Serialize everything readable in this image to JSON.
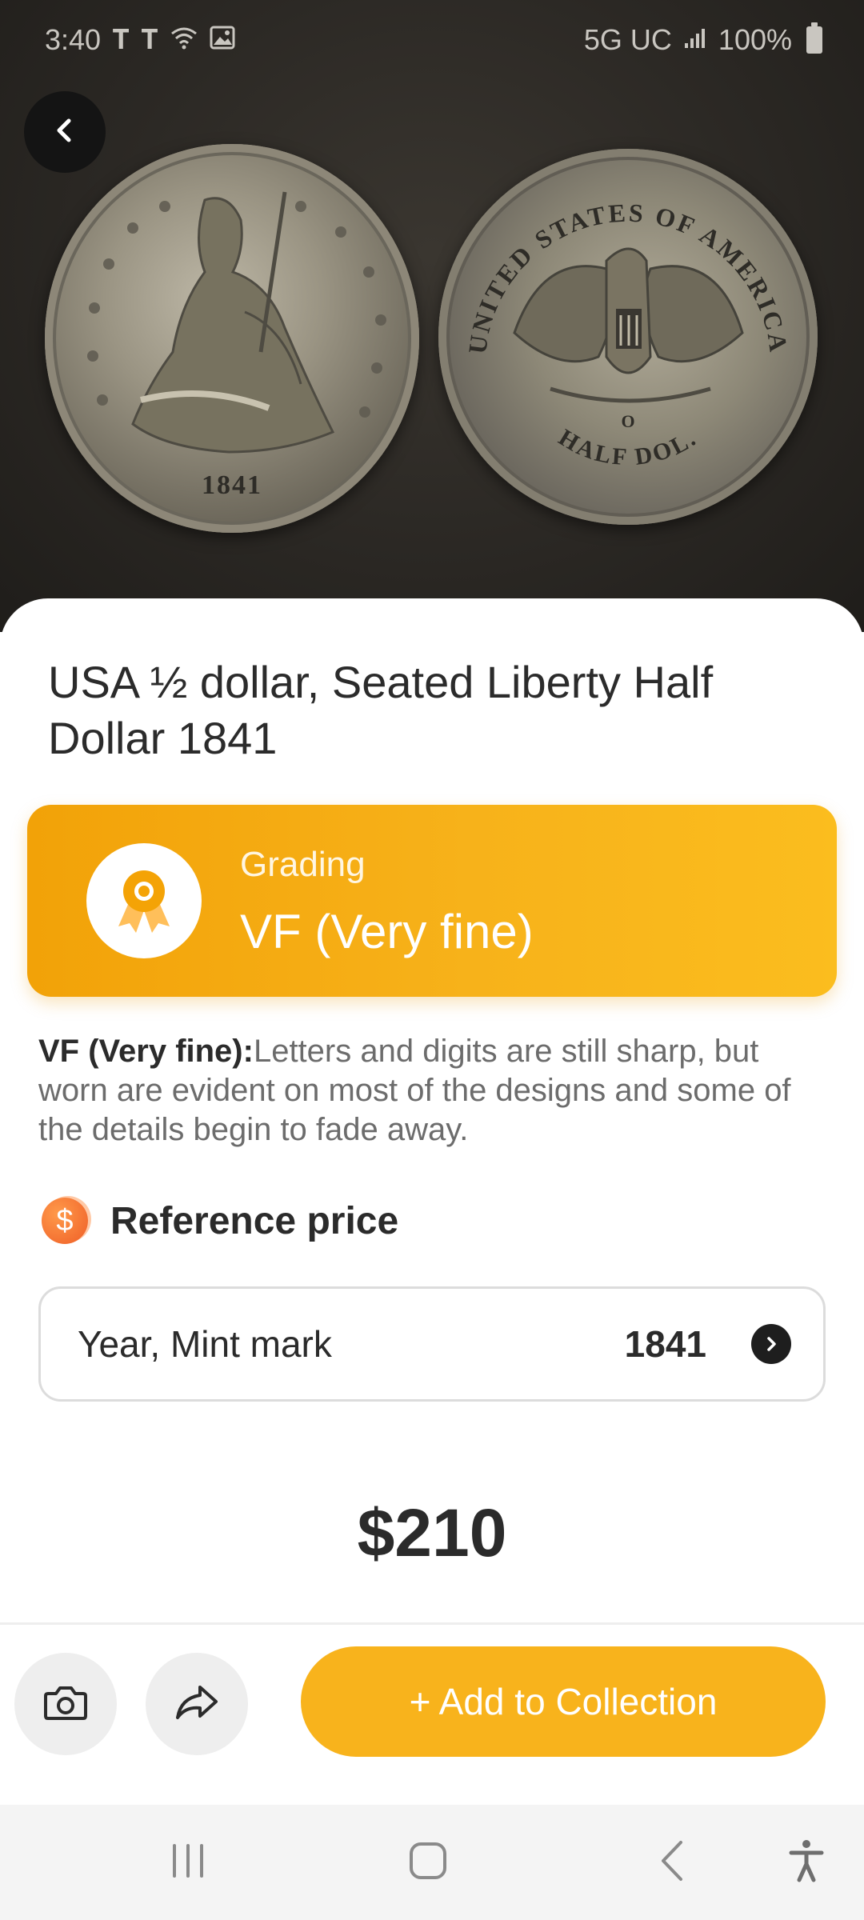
{
  "status_bar": {
    "time": "3:40",
    "network": "5G UC",
    "battery": "100%"
  },
  "coin": {
    "obverse_year": "1841",
    "reverse_legend": "UNITED STATES OF AMERICA",
    "reverse_denomination": "HALF DOL.",
    "mint_mark": "O"
  },
  "title": "USA ½ dollar, Seated Liberty Half Dollar 1841",
  "grading": {
    "label": "Grading",
    "value": "VF (Very fine)"
  },
  "description": {
    "term": "VF (Very fine):",
    "text": "Letters and digits are still sharp, but worn are evident on most of the designs and some of the details begin to fade away."
  },
  "reference_price": {
    "icon_symbol": "$",
    "title": "Reference price"
  },
  "year_mint": {
    "label": "Year, Mint mark",
    "value": "1841"
  },
  "price": "$210",
  "actions": {
    "add_label": "+ Add to Collection"
  },
  "colors": {
    "accent": "#f8b31c",
    "grading_start": "#f2a208",
    "grading_end": "#fbbd1e",
    "price_icon": "#f26a2e"
  },
  "icons": {
    "back": "chevron-left-icon",
    "camera": "camera-icon",
    "share": "share-icon",
    "award": "award-ribbon-icon"
  }
}
